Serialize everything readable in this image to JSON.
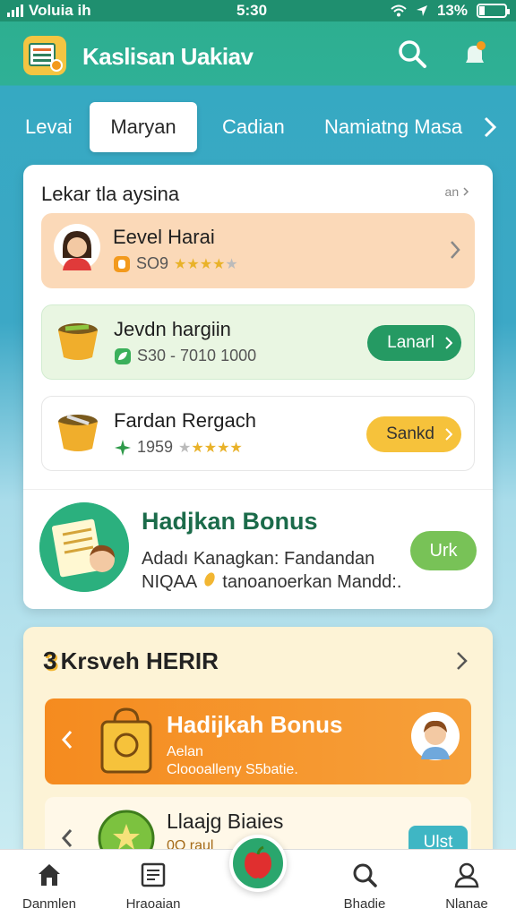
{
  "status_bar": {
    "carrier": "Voluia ih",
    "time": "5:30",
    "battery": "13%"
  },
  "header": {
    "app_title": "Kaslisan Uakiav",
    "logo_icon": "app-logo-icon",
    "search_icon": "search-icon",
    "notification_icon": "bell-icon"
  },
  "tabs": [
    {
      "label": "Levai"
    },
    {
      "label": "Maryan",
      "active": true
    },
    {
      "label": "Cadian"
    },
    {
      "label": "Namiatng Masa"
    }
  ],
  "section1": {
    "title": "Lekar tla aysina",
    "see_all": " an",
    "rows": [
      {
        "title": "Eevel Harai",
        "meta": "SO9",
        "rating_value": 3.5,
        "rating_max": 5,
        "bg": "#fbd9b8",
        "action": "chevron"
      },
      {
        "title": "Jevdn hargiin",
        "meta": "S30 - 7010 1000",
        "bg": "#e9f6e2",
        "action_label": "Lanarl",
        "action_color": "#259a63"
      },
      {
        "title": "Fardan Rergach",
        "meta": "1959",
        "rating_value": 4.5,
        "rating_max": 5,
        "bg": "#ffffff",
        "action_label": "Sankd",
        "action_color": "#f6c23b"
      }
    ]
  },
  "bonus": {
    "title": "Hadjkan Bonus",
    "desc_line1": "Adadı Kanagkan: Fandandan",
    "desc_line2_prefix": "NIQAA",
    "desc_line2": "tanoanoerkan Mandd:.",
    "button": "Urk"
  },
  "section2": {
    "number": "3",
    "title": "Krsveh HERIR",
    "promo": {
      "title": "Hadijkah Bonus",
      "sub_line1": "Aelan",
      "sub_line2": "Cloooalleny S5batie."
    },
    "promo2": {
      "title": "Llaajg Biaies",
      "sub": "0O raul",
      "button": "Ulst"
    }
  },
  "bottom_nav": [
    {
      "label": "Danmlen",
      "icon": "home-icon"
    },
    {
      "label": "Hraoaian",
      "icon": "document-icon"
    },
    {
      "label": "",
      "icon": "apple-icon"
    },
    {
      "label": "Bhadie",
      "icon": "search-icon"
    },
    {
      "label": "Nlanae",
      "icon": "profile-icon"
    }
  ],
  "colors": {
    "header_green": "#2cae8e",
    "accent_green": "#259a63",
    "accent_orange": "#f58b1f",
    "accent_yellow": "#f6c23b"
  }
}
